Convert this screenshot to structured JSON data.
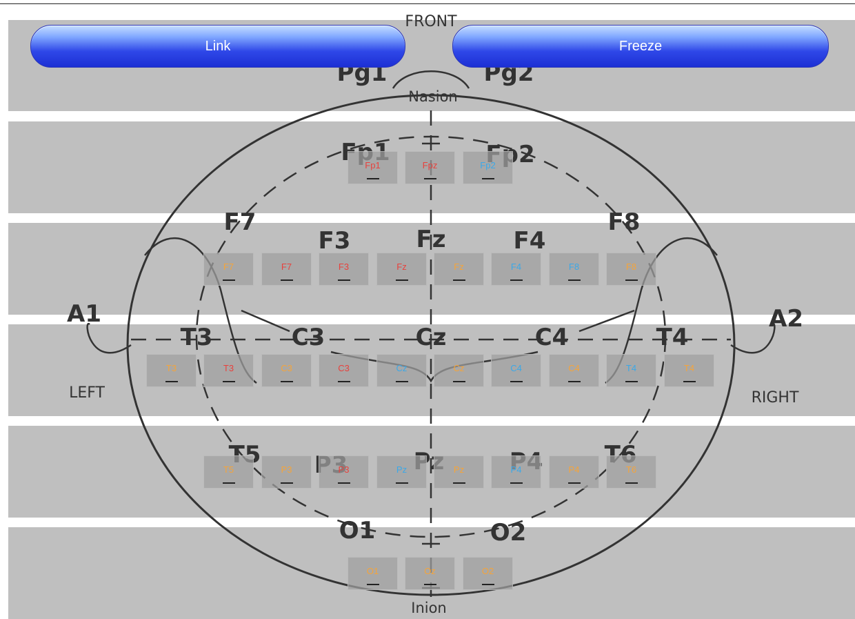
{
  "buttons": {
    "link": "Link",
    "freeze": "Freeze"
  },
  "diagram": {
    "front": "FRONT",
    "nasion": "Nasion",
    "inion": "Inion",
    "left": "LEFT",
    "right": "RIGHT",
    "pg1": "Pg1",
    "pg2": "Pg2",
    "fp1": "Fp1",
    "fp2": "Fp2",
    "f7": "F7",
    "f3": "F3",
    "fz": "Fz",
    "f4": "F4",
    "f8": "F8",
    "a1": "A1",
    "t3": "T3",
    "c3": "C3",
    "cz": "Cz",
    "c4": "C4",
    "t4": "T4",
    "a2": "A2",
    "t5": "T5",
    "p3": "P3",
    "pz": "Pz",
    "p4": "P4",
    "t6": "T6",
    "o1": "O1",
    "o2": "O2"
  },
  "colors": {
    "red": "#e8413c",
    "orange": "#f5a43a",
    "blue": "#3ba8e8"
  },
  "rows": [
    {
      "cells": [
        {
          "label": "Fp1",
          "color": "red"
        },
        {
          "label": "Fpz",
          "color": "red"
        },
        {
          "label": "Fp2",
          "color": "blue"
        }
      ]
    },
    {
      "cells": [
        {
          "label": "F7",
          "color": "orange"
        },
        {
          "label": "F7",
          "color": "red"
        },
        {
          "label": "F3",
          "color": "red"
        },
        {
          "label": "Fz",
          "color": "red"
        },
        {
          "label": "Fz",
          "color": "orange"
        },
        {
          "label": "F4",
          "color": "blue"
        },
        {
          "label": "F8",
          "color": "blue"
        },
        {
          "label": "F8",
          "color": "orange"
        }
      ]
    },
    {
      "cells": [
        {
          "label": "T3",
          "color": "orange"
        },
        {
          "label": "T3",
          "color": "red"
        },
        {
          "label": "C3",
          "color": "orange"
        },
        {
          "label": "C3",
          "color": "red"
        },
        {
          "label": "Cz",
          "color": "blue"
        },
        {
          "label": "Cz",
          "color": "orange"
        },
        {
          "label": "C4",
          "color": "blue"
        },
        {
          "label": "C4",
          "color": "orange"
        },
        {
          "label": "T4",
          "color": "blue"
        },
        {
          "label": "T4",
          "color": "orange"
        }
      ]
    },
    {
      "cells": [
        {
          "label": "T5",
          "color": "orange"
        },
        {
          "label": "P3",
          "color": "orange"
        },
        {
          "label": "P3",
          "color": "red"
        },
        {
          "label": "Pz",
          "color": "blue"
        },
        {
          "label": "Pz",
          "color": "orange"
        },
        {
          "label": "P4",
          "color": "blue"
        },
        {
          "label": "P4",
          "color": "orange"
        },
        {
          "label": "T6",
          "color": "orange"
        }
      ]
    },
    {
      "cells": [
        {
          "label": "O1",
          "color": "orange"
        },
        {
          "label": "Oz",
          "color": "orange"
        },
        {
          "label": "O2",
          "color": "orange"
        }
      ]
    }
  ]
}
